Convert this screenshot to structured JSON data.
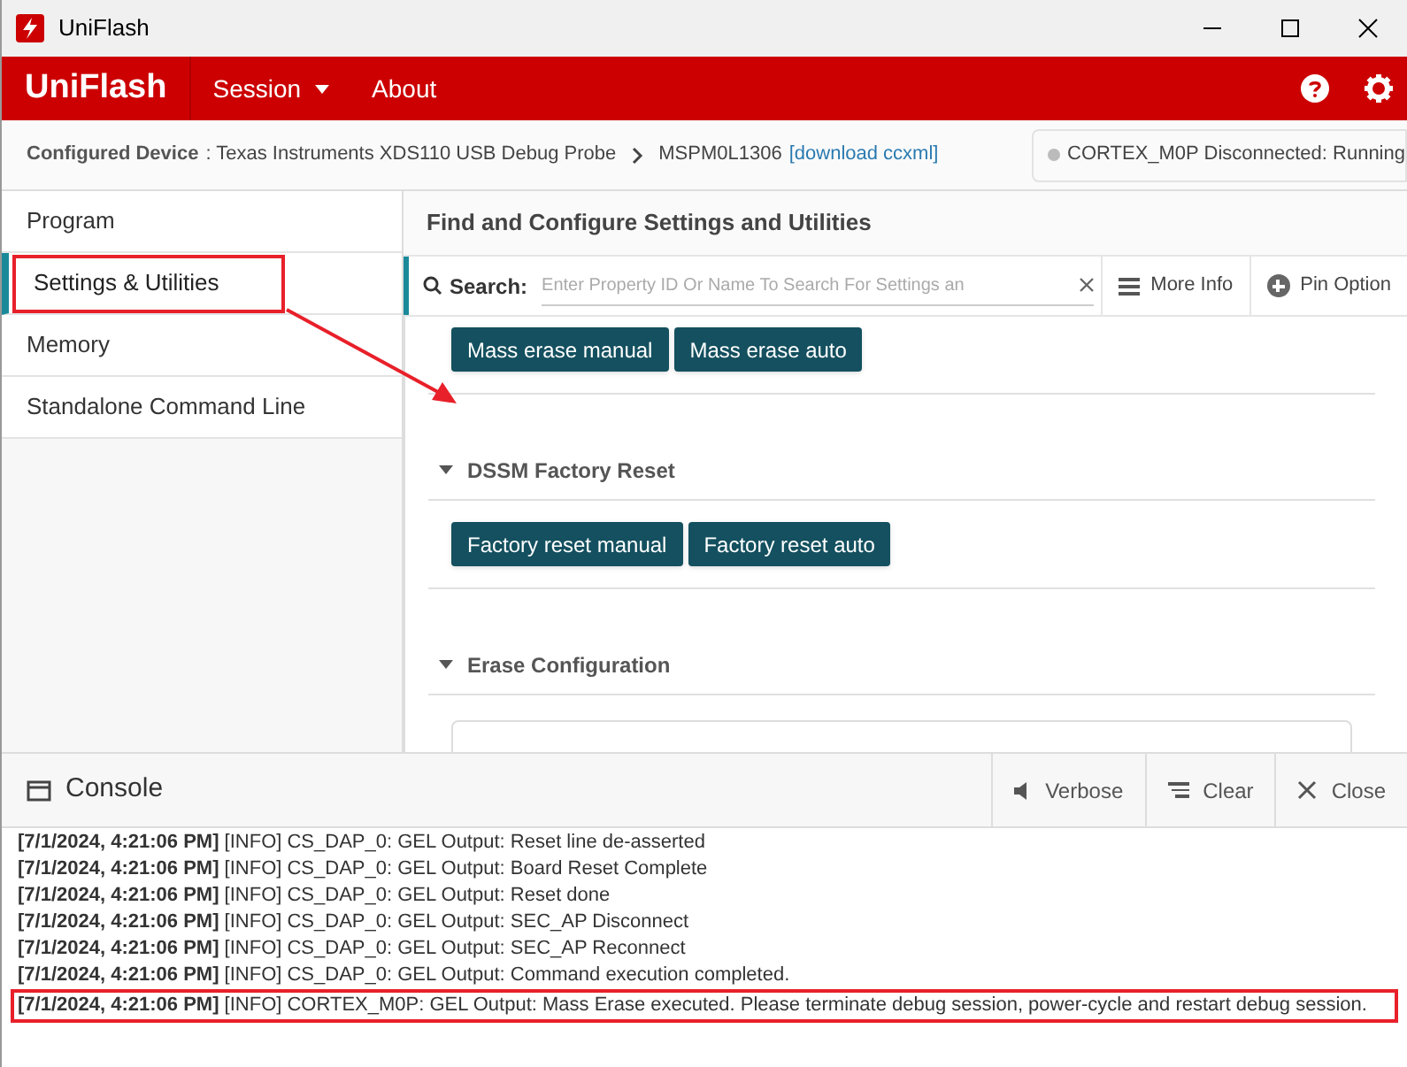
{
  "window": {
    "title": "UniFlash"
  },
  "header": {
    "logo": "UniFlash",
    "menu": [
      {
        "label": "Session",
        "dropdown": true
      },
      {
        "label": "About",
        "dropdown": false
      }
    ]
  },
  "device_bar": {
    "label": "Configured Device",
    "probe": ": Texas Instruments XDS110 USB Debug Probe",
    "device": "MSPM0L1306",
    "link": "[download ccxml]",
    "status": "CORTEX_M0P Disconnected: Running"
  },
  "sidebar": {
    "items": [
      {
        "label": "Program",
        "selected": false,
        "highlighted": false
      },
      {
        "label": "Settings & Utilities",
        "selected": true,
        "highlighted": true
      },
      {
        "label": "Memory",
        "selected": false,
        "highlighted": false
      },
      {
        "label": "Standalone Command Line",
        "selected": false,
        "highlighted": false
      }
    ]
  },
  "content": {
    "title": "Find and Configure Settings and Utilities",
    "search": {
      "label": "Search:",
      "placeholder": "Enter Property ID Or Name To Search For Settings an"
    },
    "toolbar": [
      {
        "kind": "list",
        "label": "More Info"
      },
      {
        "kind": "pin",
        "label": "Pin Option"
      }
    ],
    "sections": [
      {
        "buttons": [
          "Mass erase manual",
          "Mass erase auto"
        ]
      },
      {
        "title": "DSSM Factory Reset",
        "expanded": true,
        "buttons": [
          "Factory reset manual",
          "Factory reset auto"
        ]
      },
      {
        "title": "Erase Configuration",
        "expanded": true
      }
    ]
  },
  "console": {
    "title": "Console",
    "actions": [
      {
        "kind": "speaker",
        "label": "Verbose"
      },
      {
        "kind": "lines",
        "label": "Clear"
      },
      {
        "kind": "close",
        "label": "Close"
      }
    ],
    "lines": [
      {
        "text": "**[7/1/2024, 4:21:06 PM]** [INFO] CS_DAP_0: GEL Output: Reset line de-asserted",
        "highlighted": false
      },
      {
        "text": "**[7/1/2024, 4:21:06 PM]** [INFO] CS_DAP_0: GEL Output: Board Reset Complete",
        "highlighted": false
      },
      {
        "text": "**[7/1/2024, 4:21:06 PM]** [INFO] CS_DAP_0: GEL Output: Reset done",
        "highlighted": false
      },
      {
        "text": "**[7/1/2024, 4:21:06 PM]** [INFO] CS_DAP_0: GEL Output: SEC_AP Disconnect",
        "highlighted": false
      },
      {
        "text": "**[7/1/2024, 4:21:06 PM]** [INFO] CS_DAP_0: GEL Output: SEC_AP Reconnect",
        "highlighted": false
      },
      {
        "text": "**[7/1/2024, 4:21:06 PM]** [INFO] CS_DAP_0: GEL Output: Command execution completed.",
        "highlighted": false
      },
      {
        "text": "**[7/1/2024, 4:21:06 PM]** [INFO] CORTEX_M0P: GEL Output: Mass Erase executed. Please terminate debug session, power-cycle and restart debug session.",
        "highlighted": true
      }
    ]
  }
}
